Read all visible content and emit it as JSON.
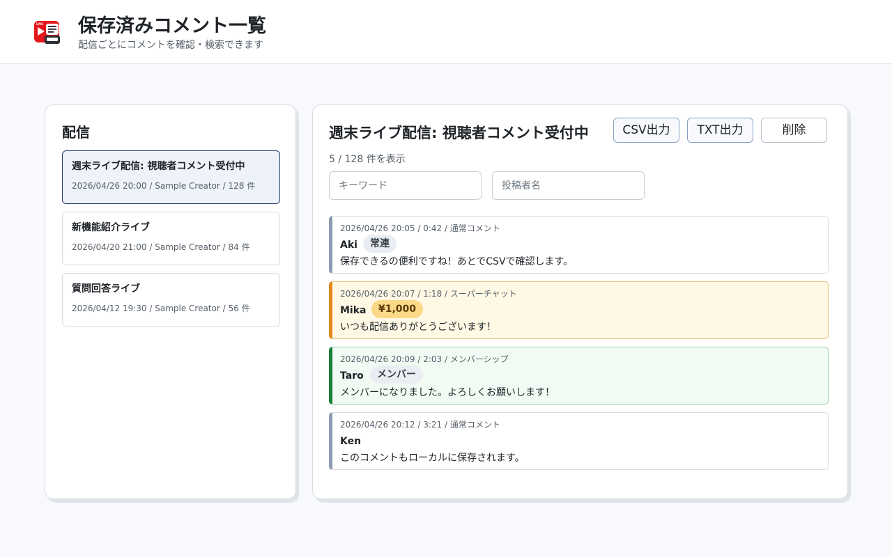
{
  "app": {
    "title": "保存済みコメント一覧",
    "subtitle": "配信ごとにコメントを確認・検索できます",
    "logo_icon": "live-comment-app-icon"
  },
  "sidebar": {
    "heading": "配信",
    "streams": [
      {
        "title": "週末ライブ配信: 視聴者コメント受付中",
        "meta": "2026/04/26 20:00 / Sample Creator / 128 件",
        "active": true
      },
      {
        "title": "新機能紹介ライブ",
        "meta": "2026/04/20 21:00 / Sample Creator / 84 件",
        "active": false
      },
      {
        "title": "質問回答ライブ",
        "meta": "2026/04/12 19:30 / Sample Creator / 56 件",
        "active": false
      }
    ]
  },
  "detail": {
    "title": "週末ライブ配信: 視聴者コメント受付中",
    "buttons": {
      "csv": "CSV出力",
      "txt": "TXT出力",
      "delete": "削除"
    },
    "count": "5 / 128 件を表示",
    "filters": {
      "keyword_placeholder": "キーワード",
      "keyword_value": "",
      "author_placeholder": "投稿者名",
      "author_value": ""
    },
    "comments": [
      {
        "meta": "2026/04/26 20:05 / 0:42 / 通常コメント",
        "author": "Aki",
        "badge": "常連",
        "text": "保存できるの便利ですね！あとでCSVで確認します。",
        "kind": "normal"
      },
      {
        "meta": "2026/04/26 20:07 / 1:18 / スーパーチャット",
        "author": "Mika",
        "badge": "¥1,000",
        "text": "いつも配信ありがとうございます！",
        "kind": "superchat"
      },
      {
        "meta": "2026/04/26 20:09 / 2:03 / メンバーシップ",
        "author": "Taro",
        "badge": "メンバー",
        "text": "メンバーになりました。よろしくお願いします！",
        "kind": "membership"
      },
      {
        "meta": "2026/04/26 20:12 / 3:21 / 通常コメント",
        "author": "Ken",
        "badge": "",
        "text": "このコメントもローカルに保存されます。",
        "kind": "normal"
      }
    ]
  },
  "colors": {
    "accent_border": "#1f3d6e",
    "superchat_bar": "#e08a1e",
    "superchat_bg": "#fff8e5",
    "membership_bar": "#1a7f37",
    "membership_bg": "#f2faf4",
    "normal_bar": "#8f9bb0",
    "logo_red": "#e4161c"
  }
}
